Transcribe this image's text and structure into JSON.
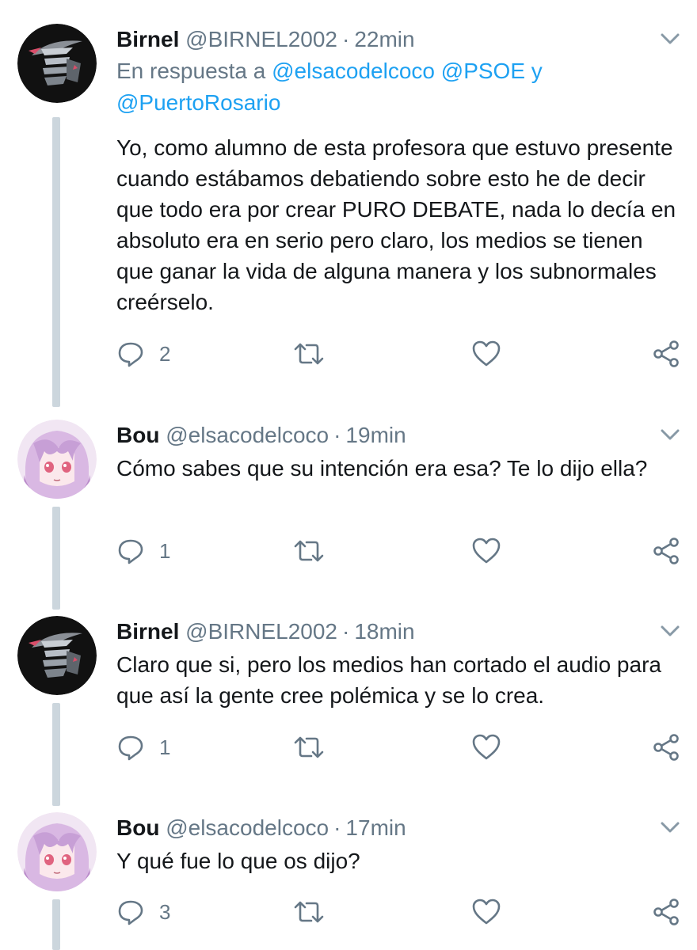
{
  "colors": {
    "text": "#14171a",
    "secondary": "#657786",
    "link": "#1da1f2",
    "thread_line": "#ccd6dd"
  },
  "icons": {
    "reply": "reply-icon",
    "retweet": "retweet-icon",
    "like": "heart-icon",
    "share": "share-icon",
    "more": "chevron-down-icon"
  },
  "tweets": [
    {
      "name": "Birnel",
      "handle": "@BIRNEL2002",
      "separator": "·",
      "time": "22min",
      "reply_prefix": "En respuesta a",
      "mentions": [
        "@elsacodelcoco",
        "@PSOE"
      ],
      "mention_joiner": "y",
      "mention_last": "@PuertoRosario",
      "text": "Yo, como alumno de esta profesora que estuvo presente cuando estábamos debatiendo sobre esto he de decir que todo era por crear PURO DEBATE, nada lo decía en absoluto era en serio pero claro, los medios se tienen que ganar la vida de alguna manera y los subnormales creérselo.",
      "reply_count": "2"
    },
    {
      "name": "Bou",
      "handle": "@elsacodelcoco",
      "separator": "·",
      "time": "19min",
      "text": "Cómo sabes que su intención era esa? Te lo dijo ella?",
      "reply_count": "1"
    },
    {
      "name": "Birnel",
      "handle": "@BIRNEL2002",
      "separator": "·",
      "time": "18min",
      "text": "Claro que si, pero los medios han cortado el audio para que así la gente cree polémica y se lo crea.",
      "reply_count": "1"
    },
    {
      "name": "Bou",
      "handle": "@elsacodelcoco",
      "separator": "·",
      "time": "17min",
      "text": "Y qué fue lo que os dijo?",
      "reply_count": "3"
    }
  ]
}
